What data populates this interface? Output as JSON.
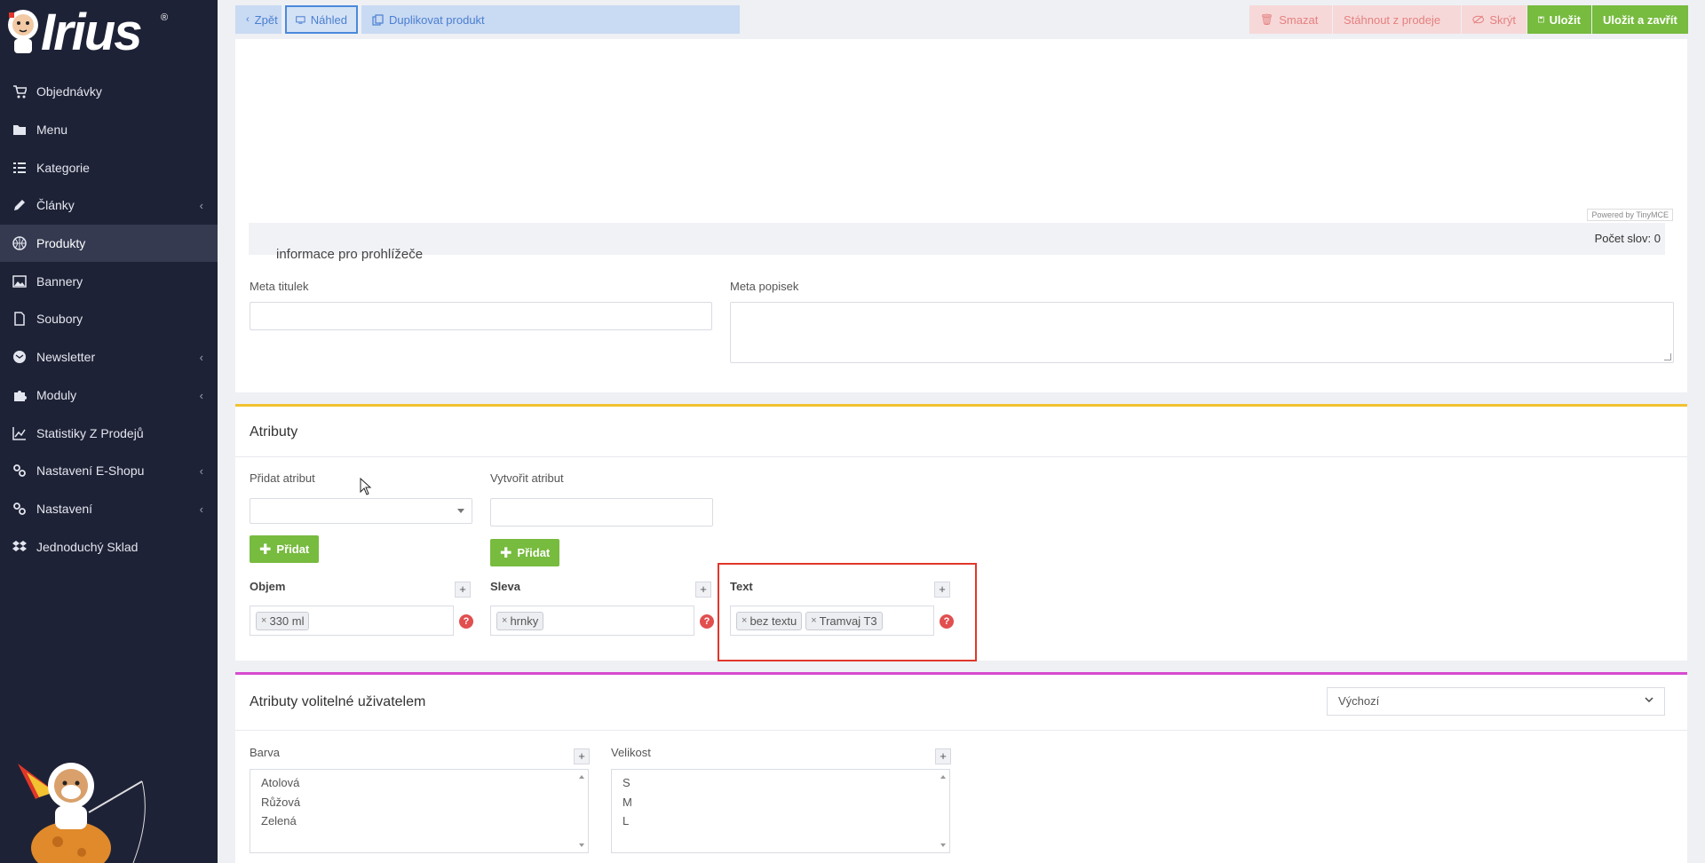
{
  "brand": {
    "name": "Irius",
    "reg": "®"
  },
  "sidebar": {
    "items": [
      {
        "label": "Objednávky",
        "icon": "cart-icon",
        "chevron": false
      },
      {
        "label": "Menu",
        "icon": "folder-icon",
        "chevron": false
      },
      {
        "label": "Kategorie",
        "icon": "list-icon",
        "chevron": false
      },
      {
        "label": "Články",
        "icon": "pencil-icon",
        "chevron": true
      },
      {
        "label": "Produkty",
        "icon": "basketball-icon",
        "chevron": false,
        "active": true
      },
      {
        "label": "Bannery",
        "icon": "image-icon",
        "chevron": false
      },
      {
        "label": "Soubory",
        "icon": "file-icon",
        "chevron": false
      },
      {
        "label": "Newsletter",
        "icon": "envelope-icon",
        "chevron": true
      },
      {
        "label": "Moduly",
        "icon": "puzzle-icon",
        "chevron": true
      },
      {
        "label": "Statistiky Z Prodejů",
        "icon": "chart-icon",
        "chevron": false
      },
      {
        "label": "Nastavení E-Shopu",
        "icon": "cogs-icon",
        "chevron": true
      },
      {
        "label": "Nastavení",
        "icon": "cogs-icon",
        "chevron": true
      },
      {
        "label": "Jednoduchý Sklad",
        "icon": "dropbox-icon",
        "chevron": false
      }
    ]
  },
  "toolbar": {
    "back": "Zpět",
    "preview": "Náhled",
    "duplicate": "Duplikovat produkt",
    "delete": "Smazat",
    "withdraw": "Stáhnout z prodeje",
    "hide": "Skrýt",
    "save": "Uložit",
    "save_close": "Uložit a zavřít"
  },
  "editor": {
    "powered": "Powered by TinyMCE",
    "wordcount": "Počet slov: 0"
  },
  "seo": {
    "section": "informace pro prohlížeče",
    "meta_title_label": "Meta titulek",
    "meta_title_value": "",
    "meta_desc_label": "Meta popisek",
    "meta_desc_value": ""
  },
  "attributes": {
    "title": "Atributy",
    "add_label": "Přidat atribut",
    "create_label": "Vytvořit atribut",
    "add_button": "Přidat",
    "create_button": "Přidat",
    "groups": [
      {
        "name": "Objem",
        "tags": [
          "330 ml"
        ]
      },
      {
        "name": "Sleva",
        "tags": [
          "hrnky"
        ]
      },
      {
        "name": "Text",
        "tags": [
          "bez textu",
          "Tramvaj T3"
        ]
      }
    ],
    "colors": {
      "accent_bar": "#f2c230",
      "highlight": "#e0372a"
    }
  },
  "user_attributes": {
    "title": "Atributy volitelné uživatelem",
    "dropdown_value": "Výchozí",
    "groups": [
      {
        "name": "Barva",
        "options": [
          "Atolová",
          "Růžová",
          "Zelená"
        ]
      },
      {
        "name": "Velikost",
        "options": [
          "S",
          "M",
          "L"
        ]
      }
    ],
    "colors": {
      "accent_bar": "#d64bd0"
    }
  }
}
